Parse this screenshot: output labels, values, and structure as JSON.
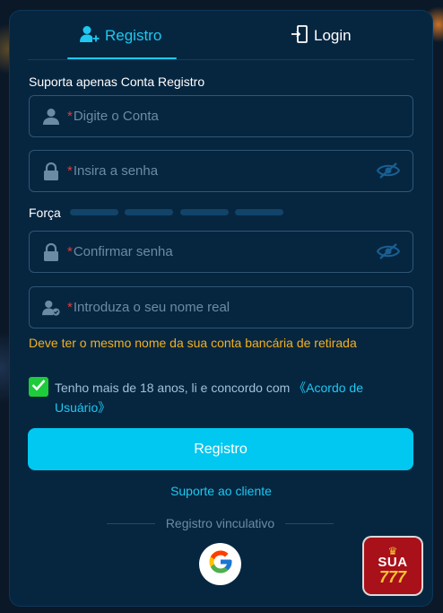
{
  "tabs": {
    "register_label": "Registro",
    "login_label": "Login"
  },
  "form": {
    "support_note": "Suporta apenas Conta Registro",
    "required_mark": "*",
    "account_placeholder": "Digite o Conta",
    "password_placeholder": "Insira a senha",
    "strength_label": "Força",
    "confirm_placeholder": "Confirmar senha",
    "realname_placeholder": "Introduza o seu nome real",
    "realname_warning": "Deve ter o mesmo nome da sua conta bancária de retirada",
    "strength_level": 0
  },
  "agreement": {
    "checked": true,
    "text": "Tenho mais de 18 anos, li e concordo com ",
    "link": "《Acordo de Usuário》"
  },
  "actions": {
    "submit_label": "Registro",
    "support_link": "Suporte ao cliente",
    "bind_label": "Registro vinculativo"
  },
  "logo": {
    "line1": "SUA",
    "line2": "777"
  },
  "colors": {
    "accent": "#1ec8f0",
    "warning": "#f4b01e",
    "checkbox": "#1ecb3a",
    "required": "#e03b3b"
  },
  "icons": [
    "user-add-icon",
    "login-door-icon",
    "user-icon",
    "lock-icon",
    "eye-off-icon",
    "user-check-icon",
    "check-icon",
    "google-icon",
    "crown-icon"
  ]
}
